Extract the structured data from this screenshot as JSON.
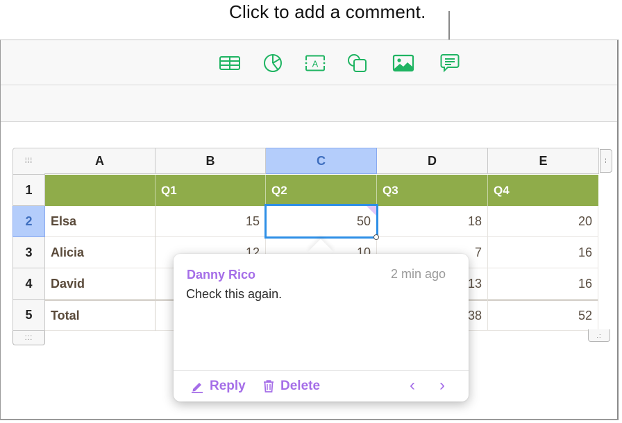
{
  "callout": {
    "text": "Click to add a comment."
  },
  "toolbar": {
    "buttons": [
      {
        "name": "table",
        "icon": "table-icon"
      },
      {
        "name": "chart",
        "icon": "chart-icon"
      },
      {
        "name": "text",
        "icon": "text-box-icon",
        "glyph": "A"
      },
      {
        "name": "shape",
        "icon": "shape-icon"
      },
      {
        "name": "media",
        "icon": "image-icon"
      },
      {
        "name": "comment",
        "icon": "comment-icon"
      }
    ],
    "accent": "#1fb462"
  },
  "table": {
    "column_headers": [
      "A",
      "B",
      "C",
      "D",
      "E"
    ],
    "selected_column": "C",
    "row_numbers": [
      "1",
      "2",
      "3",
      "4",
      "5"
    ],
    "selected_row": "2",
    "header_row": [
      "",
      "Q1",
      "Q2",
      "Q3",
      "Q4"
    ],
    "rows": [
      {
        "name": "Elsa",
        "values": [
          "15",
          "50",
          "18",
          "20"
        ]
      },
      {
        "name": "Alicia",
        "values": [
          "12",
          "10",
          "7",
          "16"
        ]
      },
      {
        "name": "David",
        "values": [
          "",
          "",
          "13",
          "16"
        ]
      },
      {
        "name": "Total",
        "values": [
          "",
          "",
          "38",
          "52"
        ]
      }
    ],
    "selected_cell": "C2",
    "header_color": "#8fac4a",
    "selection_color": "#2e8fe6"
  },
  "comment": {
    "author": "Danny Rico",
    "time": "2 min ago",
    "text": "Check this again.",
    "reply_label": "Reply",
    "delete_label": "Delete",
    "prev_glyph": "‹",
    "next_glyph": "›",
    "accent": "#a56ee8"
  }
}
